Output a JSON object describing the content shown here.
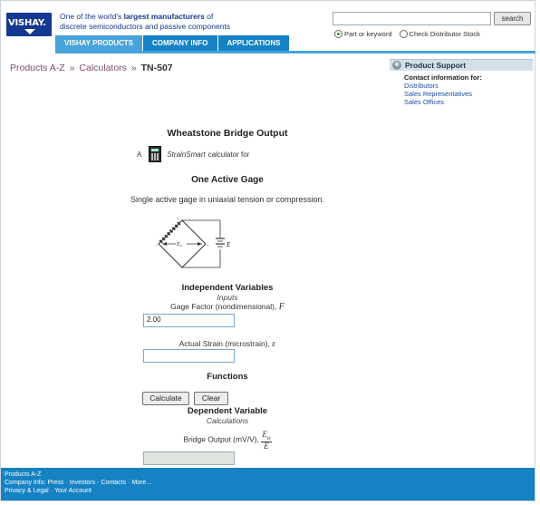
{
  "header": {
    "logo": "VISHAY.",
    "tagline_prefix": "One of the world's ",
    "tagline_bold": "largest manufacturers",
    "tagline_suffix": " of",
    "tagline_line2": "discrete semiconductors and passive components",
    "nav": [
      {
        "label": "VISHAY PRODUCTS",
        "active": true
      },
      {
        "label": "COMPANY INFO",
        "active": false
      },
      {
        "label": "APPLICATIONS",
        "active": false
      }
    ],
    "search": {
      "value": "",
      "button": "search",
      "option_part": "Part or keyword",
      "option_distributor": "Check Distributor Stock",
      "selected": "Part or keyword"
    }
  },
  "breadcrumb": {
    "items": [
      "Products A-Z",
      "Calculators"
    ],
    "separator": "»",
    "current": "TN-507"
  },
  "support": {
    "title": "Product Support",
    "contact": "Contact information for:",
    "links": [
      "Distributors",
      "Sales Representatives",
      "Sales Offices"
    ]
  },
  "main": {
    "title": "Wheatstone Bridge Output",
    "calc_prefix": "A",
    "calc_brand": "StrainSmart",
    "calc_suffix": "calculator for",
    "subtitle": "One Active Gage",
    "description": "Single active gage in uniaxial tension or compression.",
    "independent": {
      "heading": "Independent Variables",
      "sub": "Inputs",
      "gage_factor_label": "Gage Factor (nondimensional),",
      "gage_factor_symbol": "F",
      "gage_factor_value": "2.00",
      "strain_label": "Actual Strain (microstrain),",
      "strain_symbol": "ε",
      "strain_value": ""
    },
    "functions": {
      "heading": "Functions",
      "calculate": "Calculate",
      "clear": "Clear"
    },
    "dependent": {
      "heading": "Dependent Variable",
      "sub": "Calculations",
      "output_label": "Bridge Output (mV/V),",
      "frac_num": "E",
      "frac_num_sub": "o",
      "frac_den": "E",
      "output_value": ""
    }
  },
  "footer": {
    "line1": [
      "Products A-Z"
    ],
    "line2_prefix": "Company Info:",
    "line2": [
      "Press",
      "Investors",
      "Contacts",
      "More..."
    ],
    "line3": [
      "Privacy & Legal",
      "Your Account"
    ]
  },
  "colors": {
    "brand_blue": "#14388f",
    "nav_blue": "#1582c4",
    "nav_active": "#47a3da"
  }
}
